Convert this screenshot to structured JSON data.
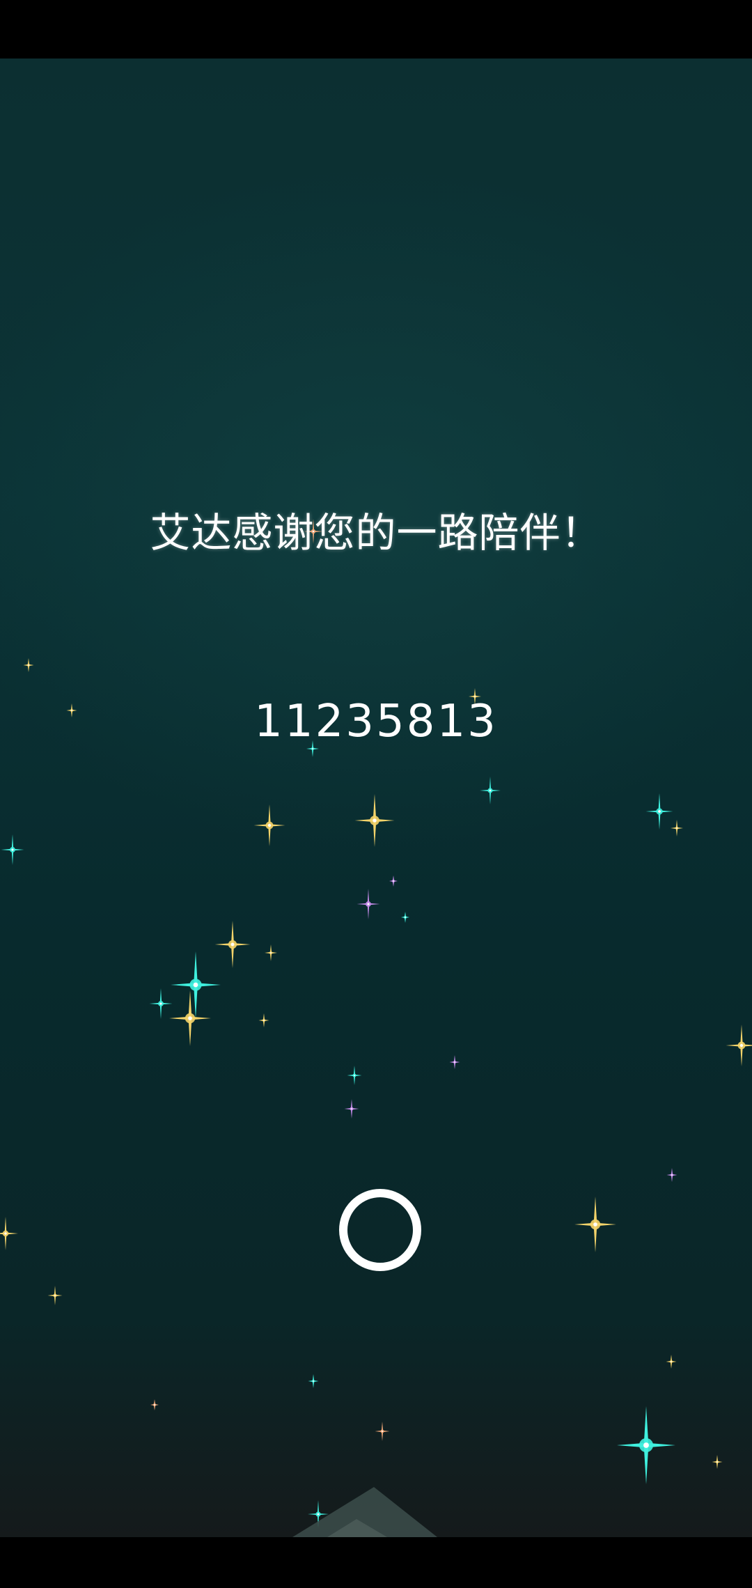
{
  "message": "艾达感谢您的一路陪伴！",
  "code": "11235813",
  "continue_icon": "ring-icon",
  "colors": {
    "background_top": "#0c2f31",
    "background_bottom": "#151a1b",
    "text": "#ffffff",
    "sparkle_gold": "#f3d36a",
    "sparkle_cyan": "#3ff0de",
    "sparkle_violet": "#c58bea",
    "sparkle_peach": "#f0a878"
  }
}
